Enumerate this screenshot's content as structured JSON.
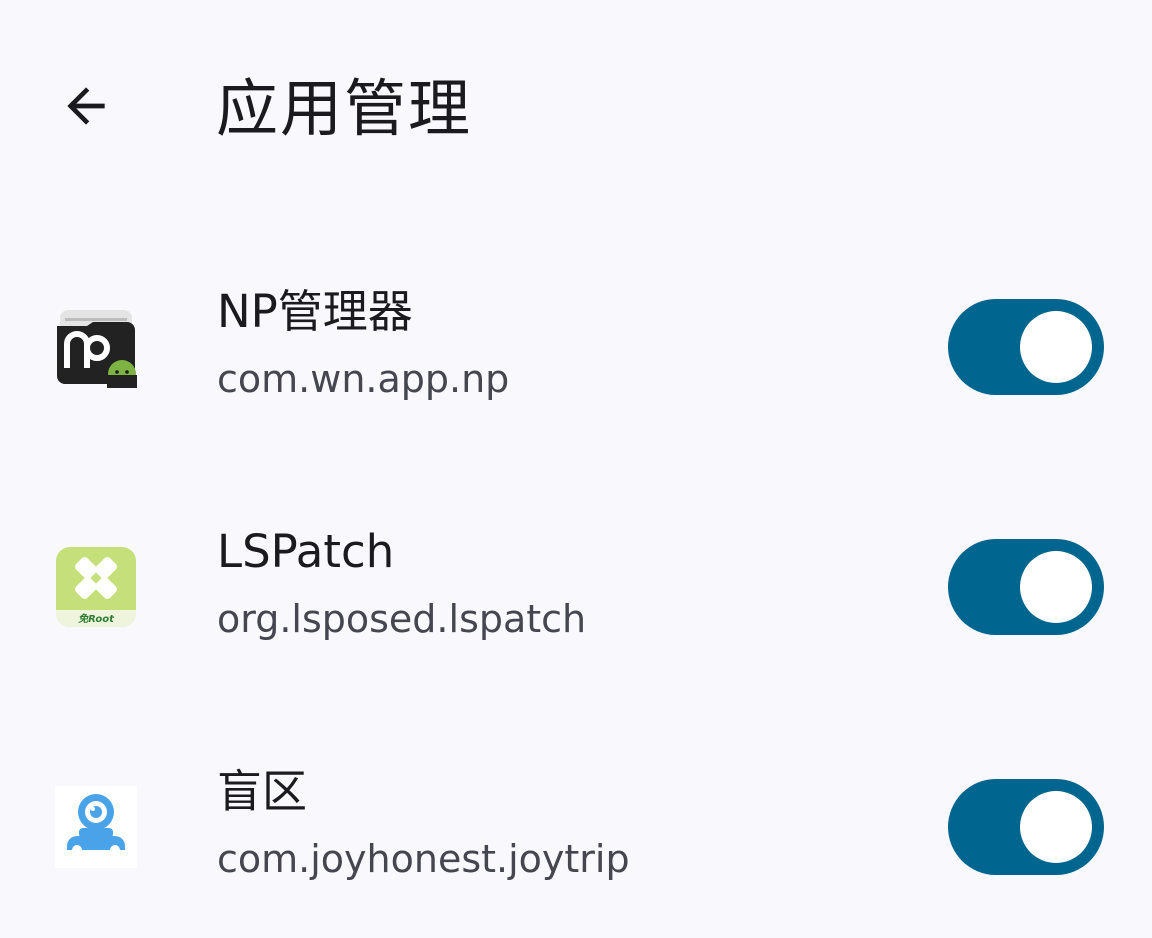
{
  "header": {
    "title": "应用管理",
    "back_icon": "arrow-back-icon"
  },
  "colors": {
    "background": "#f9f9fd",
    "toggle_on": "#00658f",
    "toggle_thumb": "#ffffff",
    "text_primary": "#1b1b1f",
    "text_secondary": "#45464f"
  },
  "apps": [
    {
      "name": "NP管理器",
      "package": "com.wn.app.np",
      "icon": "np-manager-icon",
      "enabled": true
    },
    {
      "name": "LSPatch",
      "package": "org.lsposed.lspatch",
      "icon": "lspatch-icon",
      "icon_text": "免Root",
      "enabled": true
    },
    {
      "name": "盲区",
      "package": "com.joyhonest.joytrip",
      "icon": "camera-car-icon",
      "enabled": true
    }
  ]
}
